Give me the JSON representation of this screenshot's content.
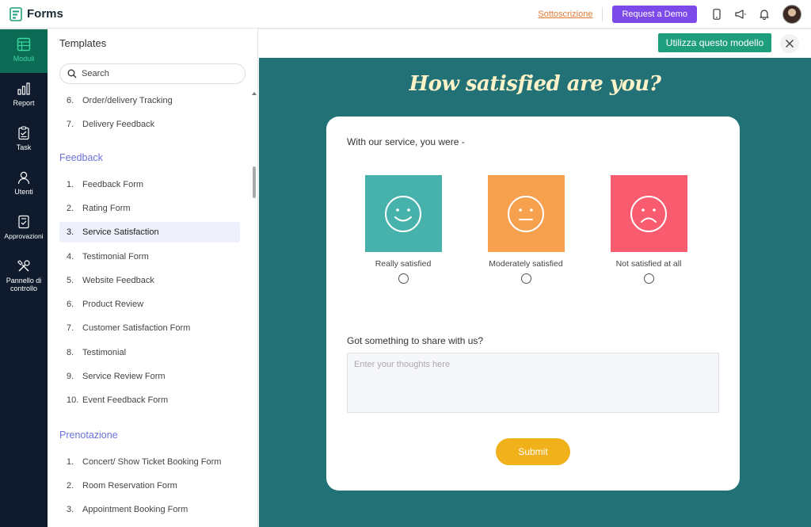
{
  "app": {
    "name": "Forms"
  },
  "topbar": {
    "subscription_link": "Sottoscrizione",
    "demo_button": "Request a Demo",
    "icons": [
      "mobile-icon",
      "megaphone-icon",
      "bell-icon"
    ]
  },
  "rail": {
    "items": [
      {
        "label": "Moduli",
        "icon": "table-icon",
        "active": true
      },
      {
        "label": "Report",
        "icon": "bar-chart-icon",
        "active": false
      },
      {
        "label": "Task",
        "icon": "clipboard-icon",
        "active": false
      },
      {
        "label": "Utenti",
        "icon": "user-icon",
        "active": false
      },
      {
        "label": "Approvazioni",
        "icon": "approval-icon",
        "active": false
      },
      {
        "label": "Pannello di controllo",
        "icon": "tools-icon",
        "active": false
      }
    ]
  },
  "templates": {
    "title": "Templates",
    "search_placeholder": "Search",
    "items_top": [
      {
        "num": "6.",
        "label": "Order/delivery Tracking"
      },
      {
        "num": "7.",
        "label": "Delivery Feedback"
      }
    ],
    "feedback": {
      "title": "Feedback",
      "items": [
        {
          "num": "1.",
          "label": "Feedback Form"
        },
        {
          "num": "2.",
          "label": "Rating Form"
        },
        {
          "num": "3.",
          "label": "Service Satisfaction"
        },
        {
          "num": "4.",
          "label": "Testimonial Form"
        },
        {
          "num": "5.",
          "label": "Website Feedback"
        },
        {
          "num": "6.",
          "label": "Product Review"
        },
        {
          "num": "7.",
          "label": "Customer Satisfaction Form"
        },
        {
          "num": "8.",
          "label": "Testimonial"
        },
        {
          "num": "9.",
          "label": "Service Review Form"
        },
        {
          "num": "10.",
          "label": "Event Feedback Form"
        }
      ]
    },
    "booking": {
      "title": "Prenotazione",
      "items": [
        {
          "num": "1.",
          "label": "Concert/ Show Ticket Booking Form"
        },
        {
          "num": "2.",
          "label": "Room Reservation Form"
        },
        {
          "num": "3.",
          "label": "Appointment Booking Form"
        }
      ]
    },
    "selected": "Service Satisfaction"
  },
  "preview_actions": {
    "use_template": "Utilizza questo modello"
  },
  "form": {
    "title": "How satisfied are you?",
    "question1": "With our service, you were -",
    "options": [
      {
        "label": "Really satisfied",
        "color": "#47b2ab",
        "icon": "happy-face-icon"
      },
      {
        "label": "Moderately satisfied",
        "color": "#f7a14f",
        "icon": "neutral-face-icon"
      },
      {
        "label": "Not satisfied at all",
        "color": "#fa5c6f",
        "icon": "sad-face-icon"
      }
    ],
    "question2": "Got something to share with us?",
    "textarea_placeholder": "Enter your thoughts here",
    "submit": "Submit"
  },
  "colors": {
    "rail_bg": "#0f1b2d",
    "rail_active": "#0b6b55",
    "preview_bg": "#217176",
    "accent_purple": "#7b4ae8",
    "accent_green": "#1e9e7c",
    "submit": "#f0b11b"
  }
}
